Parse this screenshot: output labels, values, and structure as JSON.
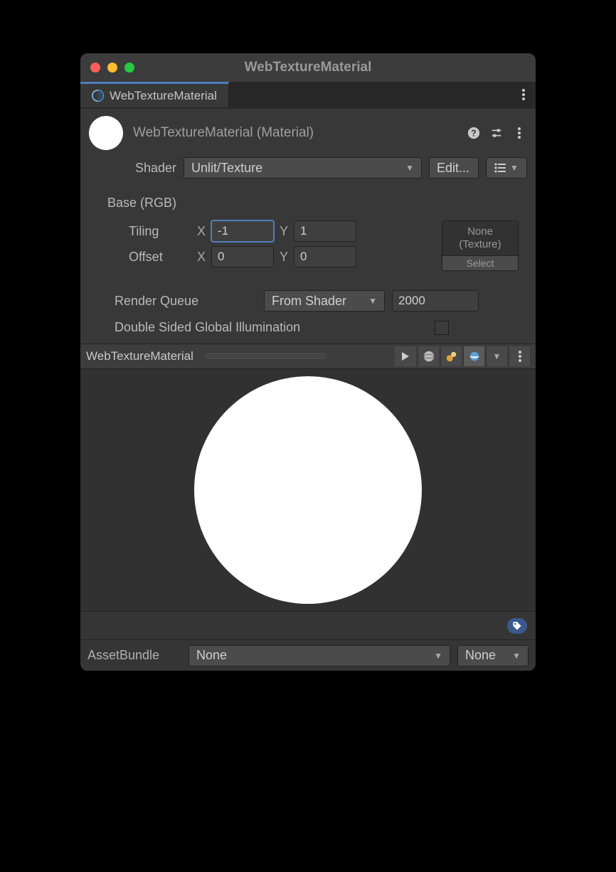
{
  "window": {
    "title": "WebTextureMaterial"
  },
  "tab": {
    "label": "WebTextureMaterial"
  },
  "header": {
    "title": "WebTextureMaterial (Material)"
  },
  "shaderRow": {
    "label": "Shader",
    "value": "Unlit/Texture",
    "editLabel": "Edit..."
  },
  "props": {
    "baseLabel": "Base (RGB)",
    "tiling": {
      "label": "Tiling",
      "x": "-1",
      "y": "1"
    },
    "offset": {
      "label": "Offset",
      "x": "0",
      "y": "0"
    },
    "textureSlot": {
      "line1": "None",
      "line2": "(Texture)",
      "select": "Select"
    }
  },
  "renderQueue": {
    "label": "Render Queue",
    "mode": "From Shader",
    "value": "2000"
  },
  "dsgi": {
    "label": "Double Sided Global Illumination",
    "checked": false
  },
  "preview": {
    "name": "WebTextureMaterial"
  },
  "assetBundle": {
    "label": "AssetBundle",
    "bundle": "None",
    "variant": "None"
  },
  "axis": {
    "x": "X",
    "y": "Y"
  }
}
